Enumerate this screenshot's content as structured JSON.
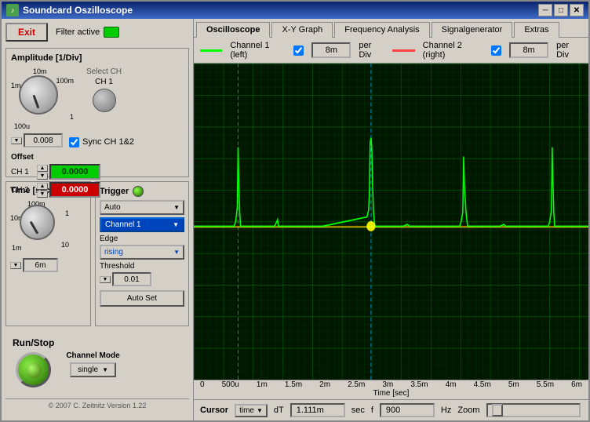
{
  "window": {
    "title": "Soundcard Oszilloscope",
    "icon": "~"
  },
  "left": {
    "exit_label": "Exit",
    "filter_label": "Filter active",
    "amplitude_title": "Amplitude [1/Div]",
    "knob_labels": {
      "top_right": "10m",
      "right": "100m",
      "bottom_right": "1",
      "left": "100u",
      "top": "1m"
    },
    "select_ch_label": "Select CH",
    "ch1_label": "CH 1",
    "sync_label": "Sync CH 1&2",
    "offset_label": "Offset",
    "ch1_offset_label": "CH 1",
    "ch2_offset_label": "CH 2",
    "ch1_offset_value": "0.0000",
    "ch2_offset_value": "0.0000",
    "amplitude_value": "0.008",
    "time_title": "Time [sec]",
    "time_knob_labels": {
      "top_right": "100m",
      "right": "1",
      "bottom_right": "10",
      "bottom_left": "1m",
      "left": "10m"
    },
    "time_value": "6m",
    "trigger_title": "Trigger",
    "trigger_mode": "Auto",
    "trigger_channel": "Channel 1",
    "edge_label": "Edge",
    "rising_label": "rising",
    "threshold_label": "Threshold",
    "threshold_value": "0.01",
    "autoset_label": "Auto Set",
    "run_stop_label": "Run/Stop",
    "channel_mode_label": "Channel Mode",
    "single_label": "single",
    "copyright": "© 2007  C. Zeitnitz Version 1.22"
  },
  "tabs": [
    {
      "label": "Oscilloscope",
      "active": true
    },
    {
      "label": "X-Y Graph",
      "active": false
    },
    {
      "label": "Frequency Analysis",
      "active": false
    },
    {
      "label": "Signalgenerator",
      "active": false
    },
    {
      "label": "Extras",
      "active": false
    }
  ],
  "channel_bar": {
    "ch1_label": "Channel 1 (left)",
    "ch1_checked": true,
    "ch1_per_div": "8m",
    "ch1_per_div_suffix": "per Div",
    "ch2_label": "Channel 2 (right)",
    "ch2_checked": true,
    "ch2_per_div": "8m",
    "ch2_per_div_suffix": "per Div"
  },
  "time_axis": {
    "labels": [
      "0",
      "500u",
      "1m",
      "1.5m",
      "2m",
      "2.5m",
      "3m",
      "3.5m",
      "4m",
      "4.5m",
      "5m",
      "5.5m",
      "6m"
    ],
    "title": "Time [sec]"
  },
  "cursor": {
    "label": "Cursor",
    "mode": "time",
    "dt_label": "dT",
    "dt_value": "1.111m",
    "dt_unit": "sec",
    "f_label": "f",
    "f_value": "900",
    "f_unit": "Hz",
    "zoom_label": "Zoom"
  }
}
